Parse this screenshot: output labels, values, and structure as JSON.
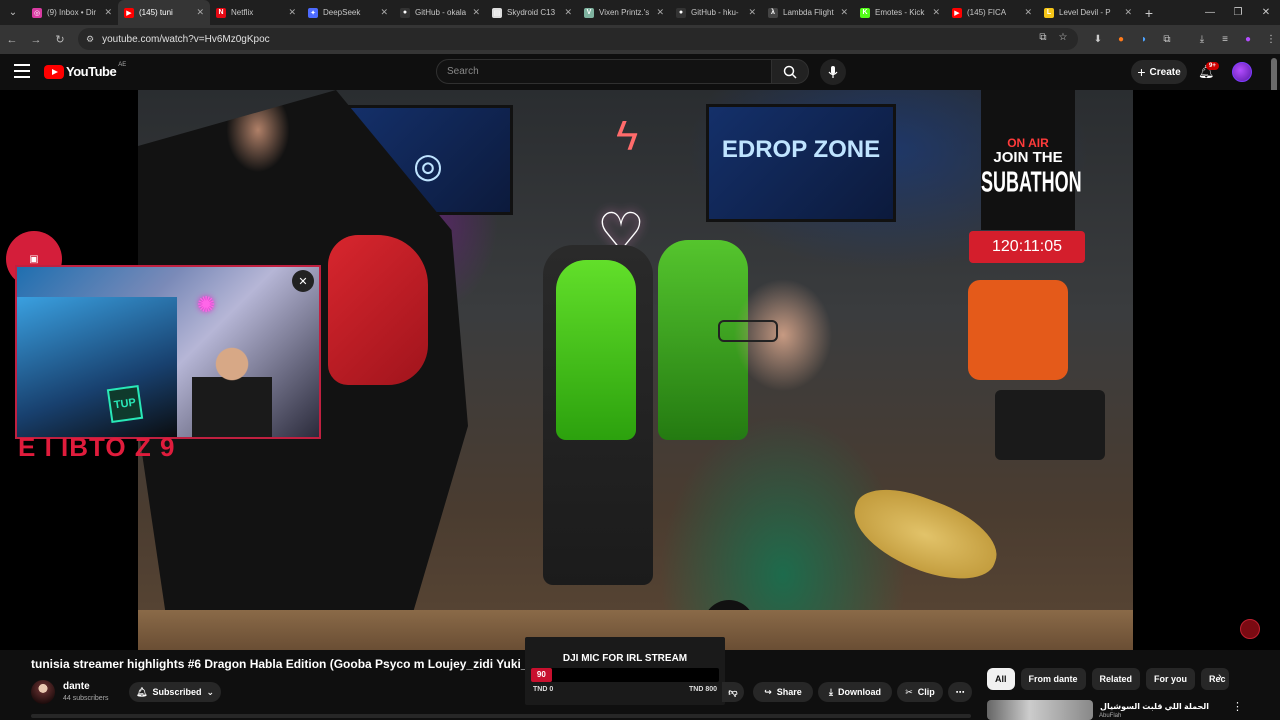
{
  "browser": {
    "tabs": [
      {
        "title": "(9) Inbox • Dir",
        "fav_color": "#d93ba2",
        "fav_glyph": "◎"
      },
      {
        "title": "(145) tuni",
        "fav_color": "#ff0000",
        "fav_glyph": "▶",
        "active": true
      },
      {
        "title": "Netflix",
        "fav_color": "#e50914",
        "fav_glyph": "N"
      },
      {
        "title": "DeepSeek",
        "fav_color": "#4d6bfe",
        "fav_glyph": "✦"
      },
      {
        "title": "GitHub - okala",
        "fav_color": "#333333",
        "fav_glyph": "●"
      },
      {
        "title": "Skydroid C13",
        "fav_color": "#dddddd",
        "fav_glyph": "▤"
      },
      {
        "title": "Vixen Printz.'s",
        "fav_color": "#7fb3a0",
        "fav_glyph": "V"
      },
      {
        "title": "GitHub - hku-",
        "fav_color": "#333333",
        "fav_glyph": "●"
      },
      {
        "title": "Lambda Flight",
        "fav_color": "#444444",
        "fav_glyph": "λ"
      },
      {
        "title": "Emotes - Kick",
        "fav_color": "#53fc18",
        "fav_glyph": "K"
      },
      {
        "title": "(145) FICA",
        "fav_color": "#ff0000",
        "fav_glyph": "▶"
      },
      {
        "title": "Level Devil - P",
        "fav_color": "#f5c518",
        "fav_glyph": "L"
      }
    ],
    "url": "youtube.com/watch?v=Hv6Mz0gKpoc"
  },
  "youtube": {
    "logo_text": "YouTube",
    "country_code": "AE",
    "search_placeholder": "Search",
    "create_label": "Create",
    "notif_badge": "9+"
  },
  "video": {
    "tv_left_text": "",
    "tv_right_text": "EDROP ZONE",
    "onair_label": "ON AIR",
    "onair_line2": "JOIN THE",
    "onair_line3": "SUBATHON",
    "timer": "120:11:05",
    "cam_badge_text": "TUP",
    "red_overlay_text": "E I IBTO Z 9"
  },
  "meta": {
    "title": "tunisia streamer highlights #6 Dragon Habla Edition (Gooba Psyco m Loujey_zidi Yuki_bl",
    "channel_name": "dante",
    "subscribers": "44 subscribers",
    "subscribed_label": "Subscribed",
    "share_label": "Share",
    "download_label": "Download",
    "clip_label": "Clip"
  },
  "promo": {
    "title": "DJI MIC FOR IRL STREAM",
    "current": "90",
    "min_label": "TND 0",
    "max_label": "TND 800",
    "progress_fraction": 0.11
  },
  "chips": [
    "All",
    "From dante",
    "Related",
    "For you",
    "Rec"
  ],
  "recommended": {
    "title": "الحملة اللي قلبت السوشيال ميديا!",
    "channel": "AbuFlah"
  }
}
